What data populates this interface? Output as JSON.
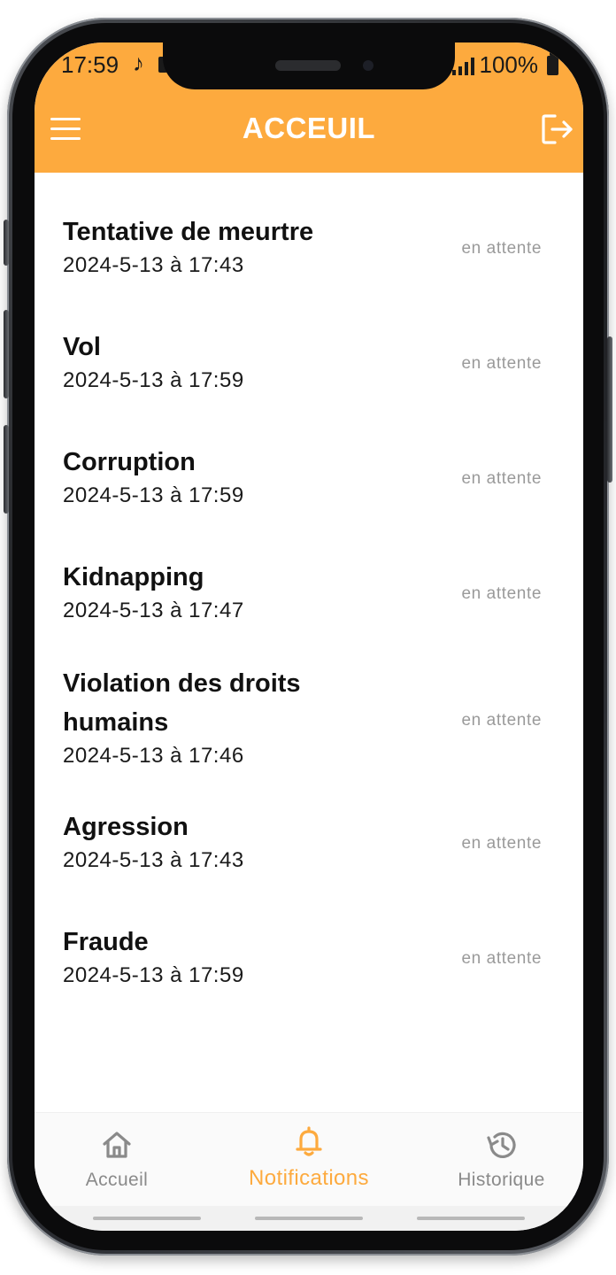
{
  "status_bar": {
    "time": "17:59",
    "battery": "100%"
  },
  "header": {
    "title": "ACCEUIL",
    "menu_icon": "hamburger-menu-icon",
    "logout_icon": "logout-icon"
  },
  "notifications": [
    {
      "title": "Tentative de meurtre",
      "date": "2024-5-13 à 17:43",
      "status": "en attente"
    },
    {
      "title": "Vol",
      "date": "2024-5-13 à 17:59",
      "status": "en attente"
    },
    {
      "title": "Corruption",
      "date": "2024-5-13 à 17:59",
      "status": "en attente"
    },
    {
      "title": "Kidnapping",
      "date": "2024-5-13 à 17:47",
      "status": "en attente"
    },
    {
      "title": "Violation des droits humains",
      "date": "2024-5-13 à 17:46",
      "status": "en attente"
    },
    {
      "title": "Agression",
      "date": "2024-5-13 à 17:43",
      "status": "en attente"
    },
    {
      "title": "Fraude",
      "date": "2024-5-13 à 17:59",
      "status": "en attente"
    }
  ],
  "bottom_nav": {
    "items": [
      {
        "label": "Accueil",
        "icon": "home-icon",
        "active": false
      },
      {
        "label": "Notifications",
        "icon": "bell-icon",
        "active": true
      },
      {
        "label": "Historique",
        "icon": "history-icon",
        "active": false
      }
    ]
  },
  "colors": {
    "accent": "#fdaa3e",
    "status_text": "#9a9a9a",
    "nav_inactive": "#8a8a8a"
  }
}
